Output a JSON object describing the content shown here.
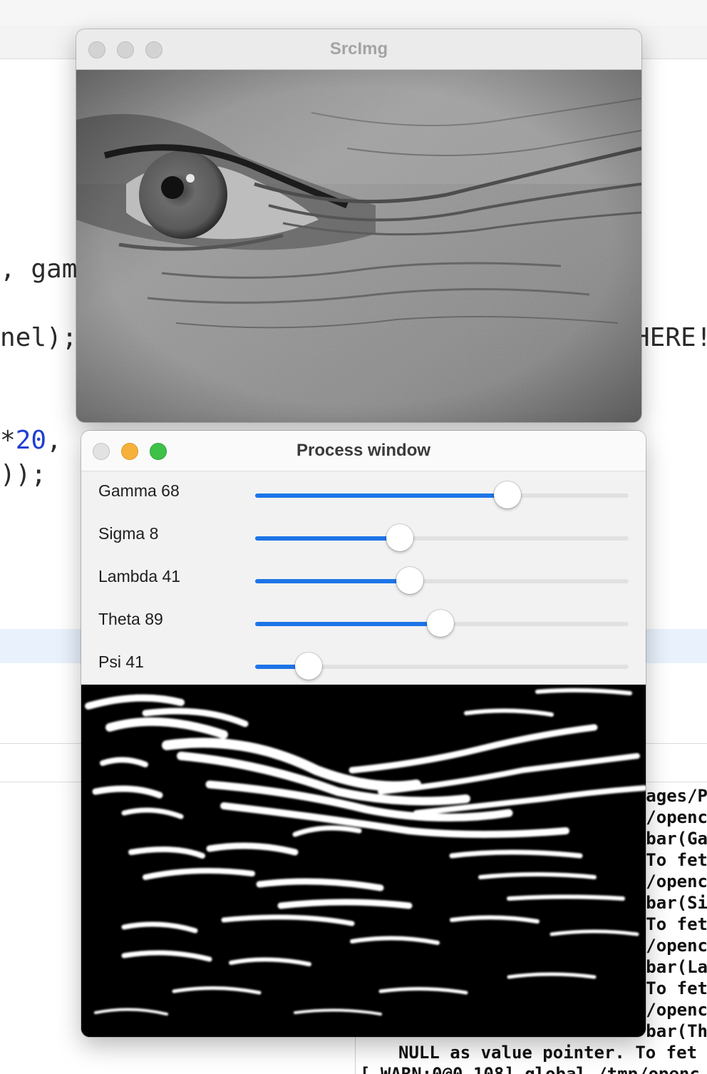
{
  "editor": {
    "code_lines": {
      "l1": ", gam",
      "l2": "nel);",
      "l2_right": "HERE!",
      "l3_star": "*",
      "l3_num": "20",
      "l3_comma": ",",
      "l4": "));"
    },
    "console_lines": [
      "ages/P",
      "/openc",
      "bar(Ga",
      "To fet",
      "/openc",
      "bar(Si",
      "To fet",
      "/openc",
      "bar(La",
      "To fet",
      "/openc",
      "bar(Th"
    ],
    "console_full_1": "NULL as value pointer. To fet",
    "console_full_2": "[ WARN:0@0.108] global /tmp/openc"
  },
  "src_window": {
    "title": "SrcImg"
  },
  "process_window": {
    "title": "Process window",
    "trackbars": [
      {
        "label": "Gamma 68",
        "fraction": 0.675
      },
      {
        "label": "Sigma 8",
        "fraction": 0.387
      },
      {
        "label": "Lambda 41",
        "fraction": 0.415
      },
      {
        "label": "Theta 89",
        "fraction": 0.497
      },
      {
        "label": "Psi 41",
        "fraction": 0.143
      }
    ]
  },
  "colors": {
    "slider_accent": "#1e74e8",
    "traffic_min": "#f6b13a",
    "traffic_max": "#3ec148"
  }
}
